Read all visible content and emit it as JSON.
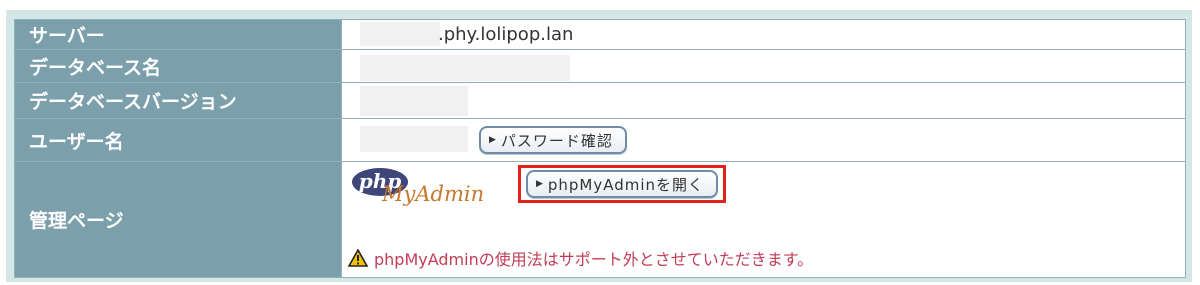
{
  "rows": [
    {
      "label": "サーバー",
      "value": ".phy.lolipop.lan"
    },
    {
      "label": "データベース名",
      "value": ""
    },
    {
      "label": "データベースバージョン",
      "value": ""
    },
    {
      "label": "ユーザー名",
      "value": "",
      "button": "パスワード確認"
    },
    {
      "label": "管理ページ"
    }
  ],
  "admin": {
    "logo_php": "php",
    "logo_myadmin": "MyAdmin",
    "open_button": "phpMyAdminを開く",
    "warning": "phpMyAdminの使用法はサポート外とさせていただきます。"
  },
  "icons": {
    "button_arrow": "play-icon",
    "warning": "warning-icon"
  },
  "colors": {
    "label_bg": "#7ca0ab",
    "frame_bg": "#d4e6e6",
    "highlight": "#e32219",
    "warning_text": "#c33d56"
  }
}
